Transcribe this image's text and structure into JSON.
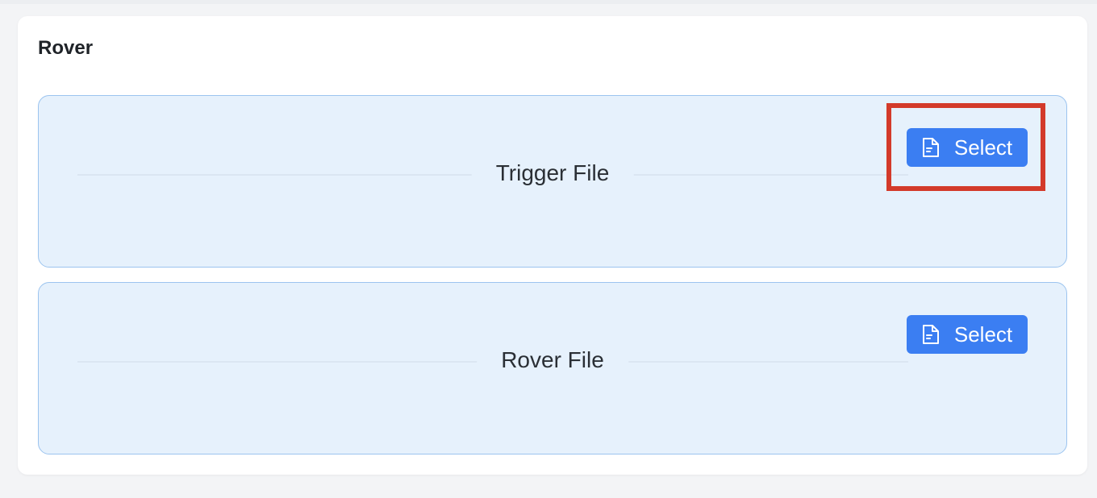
{
  "panel": {
    "title": "Rover"
  },
  "uploads": [
    {
      "label": "Trigger File",
      "button_label": "Select",
      "button_icon": "file-icon"
    },
    {
      "label": "Rover File",
      "button_label": "Select",
      "button_icon": "file-icon"
    }
  ],
  "colors": {
    "accent": "#3b7ef2",
    "zone_background": "#e6f1fc",
    "zone_border": "#9cc4ef",
    "highlight": "#d33a2a"
  }
}
